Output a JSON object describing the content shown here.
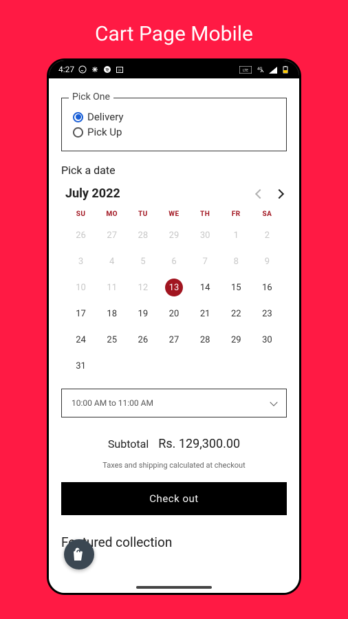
{
  "page_title": "Cart Page Mobile",
  "status": {
    "time": "4:27",
    "icons_left": [
      "whatsapp-icon",
      "slack-icon",
      "spotify-icon",
      "calendar-31-icon"
    ],
    "icons_right": [
      "lte-icon",
      "4g-signal-icon",
      "signal-icon",
      "battery-icon"
    ]
  },
  "pick_one": {
    "legend": "Pick One",
    "options": [
      {
        "label": "Delivery",
        "checked": true
      },
      {
        "label": "Pick Up",
        "checked": false
      }
    ]
  },
  "date": {
    "label": "Pick a date",
    "month": "July 2022",
    "dow": [
      "SU",
      "MO",
      "TU",
      "WE",
      "TH",
      "FR",
      "SA"
    ],
    "selected": 13,
    "prev_trailing": [
      26,
      27,
      28,
      29,
      30,
      1,
      2
    ],
    "weeks": [
      [
        3,
        4,
        5,
        6,
        7,
        8,
        9
      ],
      [
        10,
        11,
        12,
        13,
        14,
        15,
        16
      ],
      [
        17,
        18,
        19,
        20,
        21,
        22,
        23
      ],
      [
        24,
        25,
        26,
        27,
        28,
        29,
        30
      ],
      [
        31,
        null,
        null,
        null,
        null,
        null,
        null
      ]
    ],
    "muted_until": 12
  },
  "time_slot": {
    "selected": "10:00 AM to 11:00 AM"
  },
  "summary": {
    "subtotal_label": "Subtotal",
    "subtotal_amount": "Rs. 129,300.00",
    "tax_note": "Taxes and shipping calculated at checkout"
  },
  "checkout_label": "Check out",
  "featured_label": "Featured collection",
  "colors": {
    "background": "#ff1a44",
    "accent_red": "#a11520",
    "accent_blue": "#1a5fd6"
  }
}
